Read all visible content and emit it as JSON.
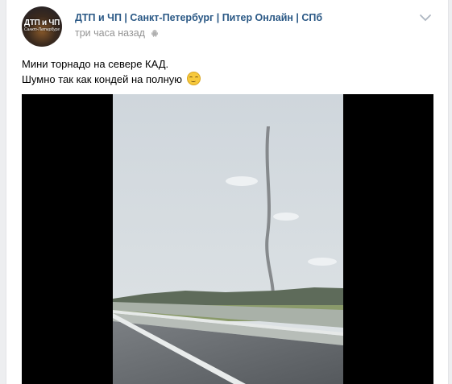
{
  "post": {
    "author": "ДТП и ЧП | Санкт-Петербург | Питер Онлайн | СПб",
    "time": "три часа назад",
    "avatar_text_main": "ДТП и ЧП",
    "avatar_text_sub": "Санкт-Петербург",
    "platform_icon": "android-icon",
    "text_line_1": "Мини торнадо на севере КАД.",
    "text_line_2": "Шумно так как кондей на полную",
    "emoji": "relieved-face",
    "media": "video"
  }
}
